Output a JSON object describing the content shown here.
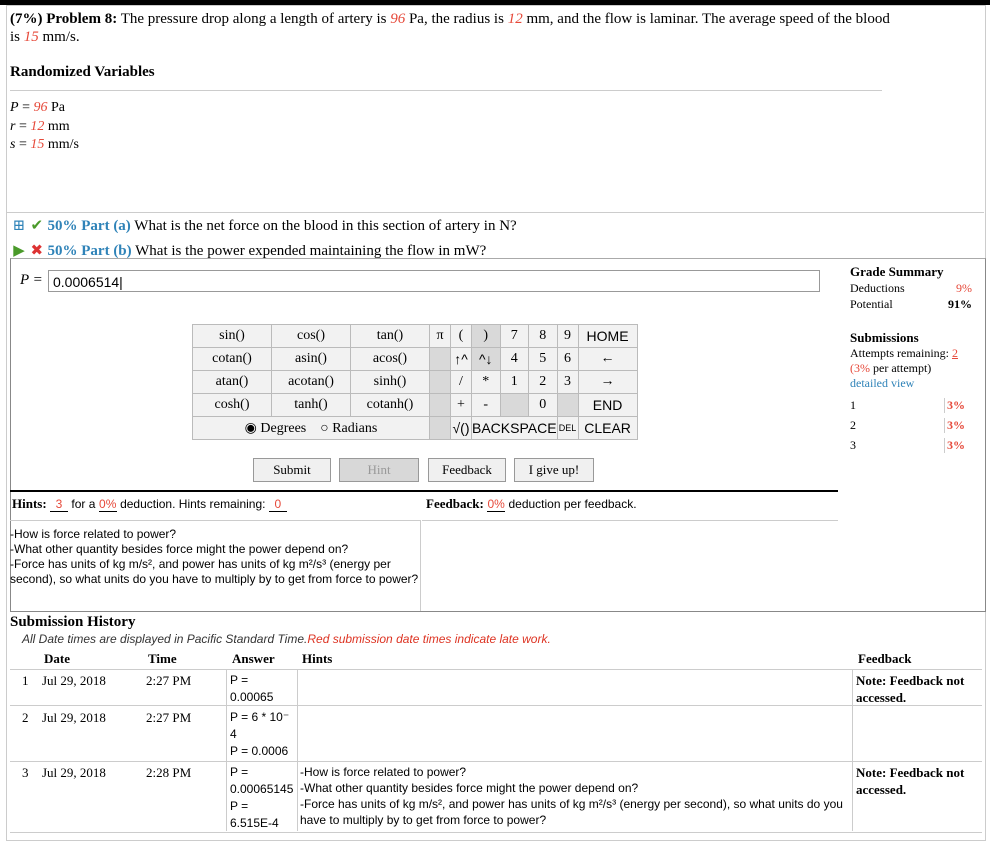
{
  "problem": {
    "pct": "(7%)",
    "label": "Problem 8:",
    "t1": "The pressure drop along a length of artery is",
    "pval": "96",
    "t2": "Pa, the radius is",
    "rval": "12",
    "t3": "mm, and the flow is laminar. The average speed of the blood is",
    "sval": "15",
    "t4": "mm/s."
  },
  "randomized": {
    "title": "Randomized Variables",
    "vars": [
      {
        "sym": "P",
        "eq": " = ",
        "val": "96",
        "unit": " Pa"
      },
      {
        "sym": "r",
        "eq": " = ",
        "val": "12",
        "unit": " mm"
      },
      {
        "sym": "s",
        "eq": " = ",
        "val": "15",
        "unit": " mm/s"
      }
    ]
  },
  "partA": {
    "pct": "50% Part (a)",
    "text": "What is the net force on the blood in this section of artery in N?"
  },
  "partB": {
    "pct": "50% Part (b)",
    "text": "What is the power expended maintaining the flow in mW?"
  },
  "answer": {
    "label": "P =",
    "value": "0.0006514|"
  },
  "calc": {
    "fns": [
      [
        "sin()",
        "cos()",
        "tan()"
      ],
      [
        "cotan()",
        "asin()",
        "acos()"
      ],
      [
        "atan()",
        "acotan()",
        "sinh()"
      ],
      [
        "cosh()",
        "tanh()",
        "cotanh()"
      ]
    ],
    "degrees": "Degrees",
    "radians": "Radians",
    "pi": "π",
    "lp": "(",
    "rp": ")",
    "up": "↑^",
    "dn": "^↓",
    "div": "/",
    "mul": "*",
    "plus": "+",
    "minus": "-",
    "sqrt": "√()",
    "backspace": "BACKSPACE",
    "del": "DEL",
    "clear": "CLEAR",
    "home": "HOME",
    "end": "END",
    "left": "←",
    "right": "→",
    "n7": "7",
    "n8": "8",
    "n9": "9",
    "n4": "4",
    "n5": "5",
    "n6": "6",
    "n1": "1",
    "n2": "2",
    "n3": "3",
    "n0": "0"
  },
  "buttons": {
    "submit": "Submit",
    "hint": "Hint",
    "feedback": "Feedback",
    "giveup": "I give up!"
  },
  "grade": {
    "title": "Grade Summary",
    "deductions_label": "Deductions",
    "deductions": "9%",
    "potential_label": "Potential",
    "potential": "91%"
  },
  "submissions": {
    "title": "Submissions",
    "remaining_label": "Attempts remaining:",
    "remaining": "2",
    "per_pct": "(3%",
    "per_rest": "per attempt)",
    "detailed": "detailed view",
    "attempts": [
      {
        "n": "1",
        "v": "3%"
      },
      {
        "n": "2",
        "v": "3%"
      },
      {
        "n": "3",
        "v": "3%"
      }
    ]
  },
  "hints": {
    "label": "Hints:",
    "count": "3",
    "for_a": "for a",
    "pct": "0%",
    "ded": "deduction. Hints remaining:",
    "remaining": "0",
    "items": [
      "-How is force related to power?",
      "-What other quantity besides force might the power depend on?",
      "-Force has units of kg m/s², and power has units of kg m²/s³ (energy per second), so what units do you have to multiply by to get from force to power?"
    ]
  },
  "feedback": {
    "label": "Feedback:",
    "pct": "0%",
    "rest": "deduction per feedback."
  },
  "history": {
    "title": "Submission History",
    "note": "All Date times are displayed in Pacific Standard Time.",
    "note_red": "Red submission date times indicate late work.",
    "headers": {
      "date": "Date",
      "time": "Time",
      "answer": "Answer",
      "hints": "Hints",
      "feedback": "Feedback"
    },
    "rows": [
      {
        "n": "1",
        "date": "Jul 29, 2018",
        "time": "2:27 PM",
        "answer": "P =\n0.00065",
        "hints": "",
        "feedback": "Note: Feedback not accessed."
      },
      {
        "n": "2",
        "date": "Jul 29, 2018",
        "time": "2:27 PM",
        "answer": "P = 6 * 10⁻\n4\nP = 0.0006",
        "hints": "",
        "feedback": ""
      },
      {
        "n": "3",
        "date": "Jul 29, 2018",
        "time": "2:28 PM",
        "answer": "P =\n0.00065145\nP =\n6.515E-4",
        "hints": "-How is force related to power?\n-What other quantity besides force might the power depend on?\n-Force has units of kg m/s², and power has units of kg m²/s³ (energy per second), so what units do you have to multiply by to get from force to power?",
        "feedback": "Note: Feedback not accessed."
      }
    ]
  }
}
